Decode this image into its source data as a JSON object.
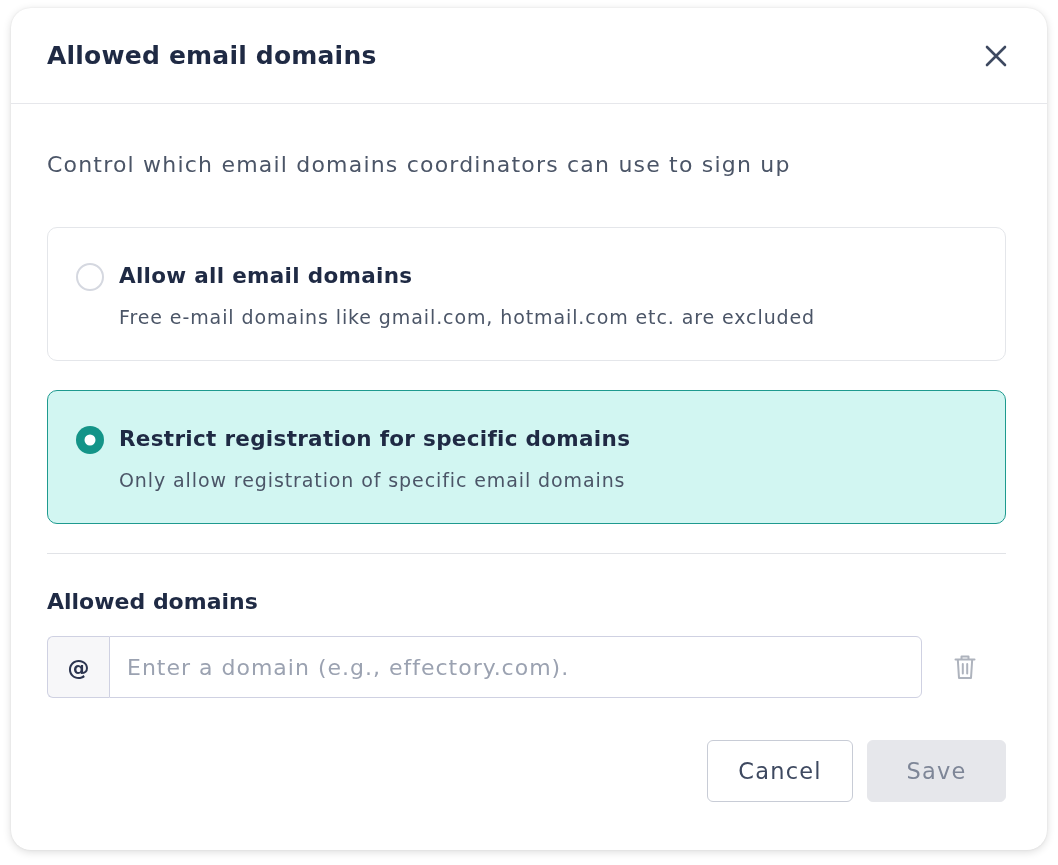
{
  "dialog": {
    "title": "Allowed email domains",
    "description": "Control which email domains coordinators can use to sign up"
  },
  "options": [
    {
      "title": "Allow all email domains",
      "description": "Free e-mail domains like gmail.com, hotmail.com etc. are excluded",
      "selected": false
    },
    {
      "title": "Restrict registration for specific domains",
      "description": "Only allow registration of specific email domains",
      "selected": true
    }
  ],
  "domains": {
    "label": "Allowed domains",
    "addon": "@",
    "placeholder": "Enter a domain (e.g., effectory.com)."
  },
  "buttons": [
    {
      "label": "Cancel",
      "kind": "secondary",
      "disabled": false
    },
    {
      "label": "Save",
      "kind": "primary",
      "disabled": true
    }
  ]
}
